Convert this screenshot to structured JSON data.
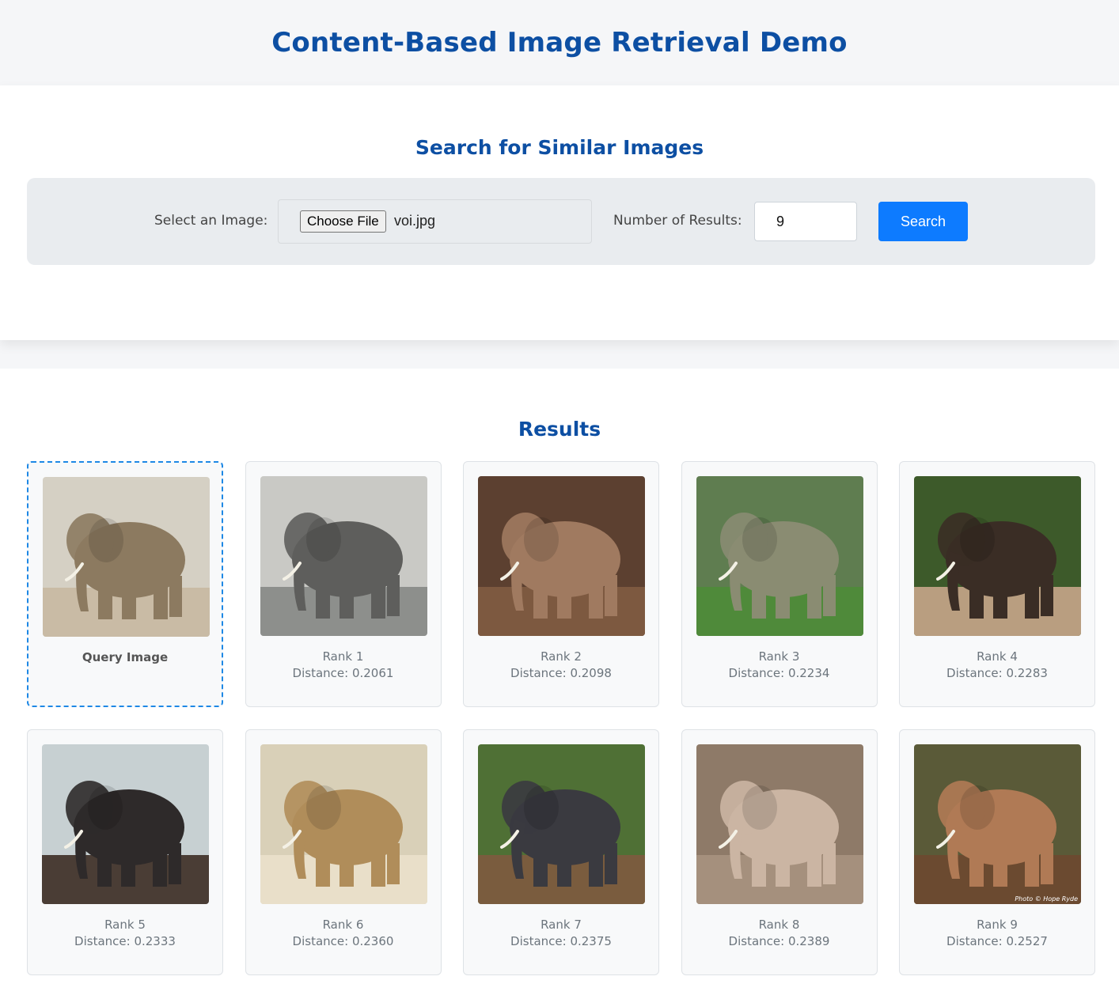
{
  "header": {
    "title": "Content-Based Image Retrieval Demo"
  },
  "search": {
    "heading": "Search for Similar Images",
    "select_label": "Select an Image:",
    "choose_file_label": "Choose File",
    "file_name": "voi.jpg",
    "results_label": "Number of Results:",
    "num_results": "9",
    "search_button": "Search"
  },
  "results": {
    "heading": "Results",
    "query_label": "Query Image",
    "items": [
      {
        "rank": "Rank 1",
        "distance": "Distance: 0.2061",
        "bg": "#c9c9c5",
        "ground": "#8d8f8c",
        "body": "#5e5e5c"
      },
      {
        "rank": "Rank 2",
        "distance": "Distance: 0.2098",
        "bg": "#5c4030",
        "ground": "#7d5940",
        "body": "#a07a60"
      },
      {
        "rank": "Rank 3",
        "distance": "Distance: 0.2234",
        "bg": "#5f7d50",
        "ground": "#4f8a3a",
        "body": "#8a8c72"
      },
      {
        "rank": "Rank 4",
        "distance": "Distance: 0.2283",
        "bg": "#3d5a2a",
        "ground": "#b99e80",
        "body": "#3a2d25"
      },
      {
        "rank": "Rank 5",
        "distance": "Distance: 0.2333",
        "bg": "#c7d0d2",
        "ground": "#4a3d35",
        "body": "#2e2a2a"
      },
      {
        "rank": "Rank 6",
        "distance": "Distance: 0.2360",
        "bg": "#d9d0b8",
        "ground": "#e9dfc9",
        "body": "#b08d5a"
      },
      {
        "rank": "Rank 7",
        "distance": "Distance: 0.2375",
        "bg": "#4f7035",
        "ground": "#7a5c3e",
        "body": "#3a3a40"
      },
      {
        "rank": "Rank 8",
        "distance": "Distance: 0.2389",
        "bg": "#8e7a68",
        "ground": "#a5907d",
        "body": "#cbb5a3"
      },
      {
        "rank": "Rank 9",
        "distance": "Distance: 0.2527",
        "bg": "#5a5a38",
        "ground": "#6b4a30",
        "body": "#b07a55",
        "watermark": "Photo © Hope Ryde"
      }
    ],
    "query_colors": {
      "bg": "#d5d0c4",
      "ground": "#c9bba5",
      "body": "#8c7a60"
    }
  }
}
